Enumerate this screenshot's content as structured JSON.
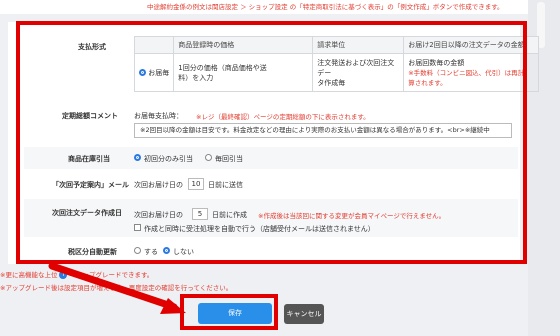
{
  "top_note": "中途解約金係の例文は関店設定 ＞ ショップ設定 の「特定商取引法に基づく表示」の「例文作成」ボタンで作成できます。",
  "payment": {
    "label": "支払形式",
    "headers": [
      "商品登録時の価格",
      "請求単位",
      "お届け2回目以降の注文データの金額"
    ],
    "option_label": "お届毎",
    "price_text": [
      "1回分の価格（商品価格や送",
      "料）を入力"
    ],
    "billing_text": [
      "注文発送および次回注文デー",
      "タ作成毎"
    ],
    "amount_text": "お届回数毎の金額",
    "amount_note": [
      "※手数料（コンビニ図込、代引）は再計",
      "算されます。"
    ]
  },
  "comment": {
    "label": "定期総額コメント",
    "prefix": "お届毎支払時：",
    "note": "※レジ（最終確認）ページの定期総額の下に表示されます。",
    "value": "※2回目以降の金額は目安です。料金改定などの理由により実際のお支払い金額は異なる場合があります。<br>※継続中"
  },
  "stock": {
    "label": "商品在庫引当",
    "options": [
      "初回分のみ引当",
      "毎回引当"
    ]
  },
  "next_mail": {
    "label": "「次回予定案内」メール",
    "prefix": "次回お届け日の",
    "value": "10",
    "suffix": "日前に送信"
  },
  "next_order": {
    "label": "次回注文データ作成日",
    "prefix": "次回お届け日の",
    "value": "5",
    "suffix": "日前に作成",
    "note": "※作成後は当該回に関する変更が会員マイページで行えません。",
    "checkbox_label": "作成と同時に受注処理を自動で行う（店舗受付メールは送信されません）"
  },
  "tax": {
    "label": "税区分自動更新",
    "options": [
      "する",
      "しない"
    ]
  },
  "footer": {
    "line1_a": "※更に高機能な上位",
    "line1_b": "へアップグレードできます。",
    "line2": "※アップグレード後は設定項目が増える為、再度設定の確認を行ってください。"
  },
  "buttons": {
    "save": "保存",
    "cancel": "キャンセル"
  },
  "colors": {
    "highlight": "#e00000",
    "accent": "#2a8fe8",
    "note_red": "#e23b2e"
  }
}
